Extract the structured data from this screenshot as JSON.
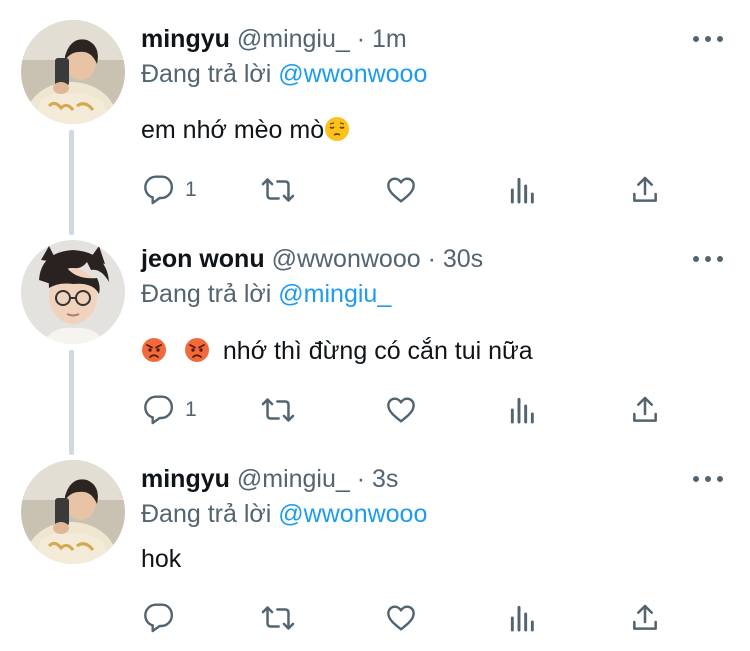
{
  "colors": {
    "text": "#0f1419",
    "secondary": "#536471",
    "link": "#1d9bf0",
    "thread_line": "#cfd9de"
  },
  "tweets": [
    {
      "name": "mingyu",
      "handle": "@mingiu_",
      "dot": "·",
      "time": "1m",
      "reply_prefix": "Đang trả lời",
      "reply_to": "@wwonwooo",
      "text": "em nhớ mèo mò",
      "text_emoji": "pensive-face",
      "reply_count": "1",
      "icons": [
        "reply-icon",
        "retweet-icon",
        "like-icon",
        "analytics-icon",
        "share-icon",
        "more-icon"
      ]
    },
    {
      "name": "jeon wonu",
      "handle": "@wwonwooo",
      "dot": "·",
      "time": "30s",
      "reply_prefix": "Đang trả lời",
      "reply_to": "@mingiu_",
      "text": "nhớ thì đừng có cắn tui nữa",
      "text_emoji": "angry-face",
      "reply_count": "1",
      "icons": [
        "reply-icon",
        "retweet-icon",
        "like-icon",
        "analytics-icon",
        "share-icon",
        "more-icon"
      ]
    },
    {
      "name": "mingyu",
      "handle": "@mingiu_",
      "dot": "·",
      "time": "3s",
      "reply_prefix": "Đang trả lời",
      "reply_to": "@wwonwooo",
      "text": "hok",
      "reply_count": "",
      "icons": [
        "reply-icon",
        "retweet-icon",
        "like-icon",
        "analytics-icon",
        "share-icon",
        "more-icon"
      ]
    }
  ]
}
